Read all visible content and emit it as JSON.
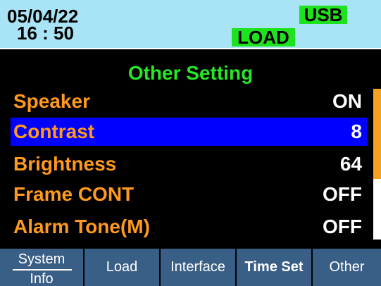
{
  "status": {
    "date": "05/04/22",
    "time": "16 : 50",
    "usb_badge": "USB",
    "load_badge": "LOAD"
  },
  "settings": {
    "title": "Other Setting",
    "items": [
      {
        "label": "Speaker",
        "value": "ON"
      },
      {
        "label": "Contrast",
        "value": "8"
      },
      {
        "label": "Brightness",
        "value": "64"
      },
      {
        "label": "Frame CONT",
        "value": "OFF"
      },
      {
        "label": "Alarm Tone(M)",
        "value": "OFF"
      }
    ],
    "selected_index": 1
  },
  "tabs": {
    "system_line1": "System",
    "system_line2": "Info",
    "load": "Load",
    "interface": "Interface",
    "time_set": "Time Set",
    "other": "Other"
  },
  "colors": {
    "status_bg": "#a8e4f5",
    "badge_green": "#1ee21e",
    "title_green": "#27e627",
    "label_orange": "#ff9a1e",
    "selection_blue": "#0000ff",
    "tab_blue": "#3a5f86"
  }
}
